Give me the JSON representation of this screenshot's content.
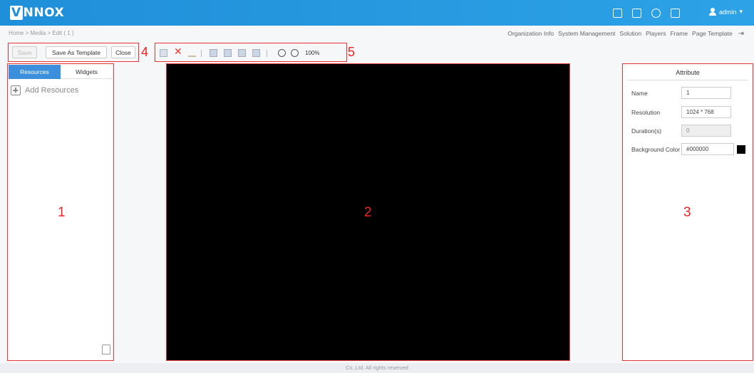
{
  "header": {
    "logo_text": "NNOX",
    "logo_mark": "V",
    "icons": [
      "grid-icon",
      "building-icon",
      "globe-icon",
      "help-icon"
    ],
    "user": "admin",
    "user_caret": "▾"
  },
  "breadcrumb": "Home > Media > Edit ( 1 )",
  "topnav": {
    "items": [
      "Organization Info",
      "System Management",
      "Solution",
      "Players",
      "Frame",
      "Page Template"
    ],
    "exit_icon": "⇥"
  },
  "toolbar": {
    "save_label": "Save",
    "save_template_label": "Save As Template",
    "close_label": "Close",
    "zoom_value": "100%",
    "del_glyph": "✕"
  },
  "callouts": {
    "n1": "1",
    "n2": "2",
    "n3": "3",
    "n4": "4",
    "n5": "5"
  },
  "left_panel": {
    "tabs": [
      "Resources",
      "Widgets"
    ],
    "add_resources": "Add Resources"
  },
  "attribute": {
    "title": "Attribute",
    "name_label": "Name",
    "name_value": "1",
    "resolution_label": "Resolution",
    "resolution_value": "1024  *  768",
    "duration_label": "Duration(s)",
    "duration_value": "0",
    "bg_label": "Background Color",
    "bg_value": "#000000",
    "bg_color": "#000000"
  },
  "colors": {
    "header": "#1f8fd9",
    "accent": "#3c8fdd",
    "callout": "#e22222"
  },
  "footer": "Co.,Ltd. All rights reserved"
}
